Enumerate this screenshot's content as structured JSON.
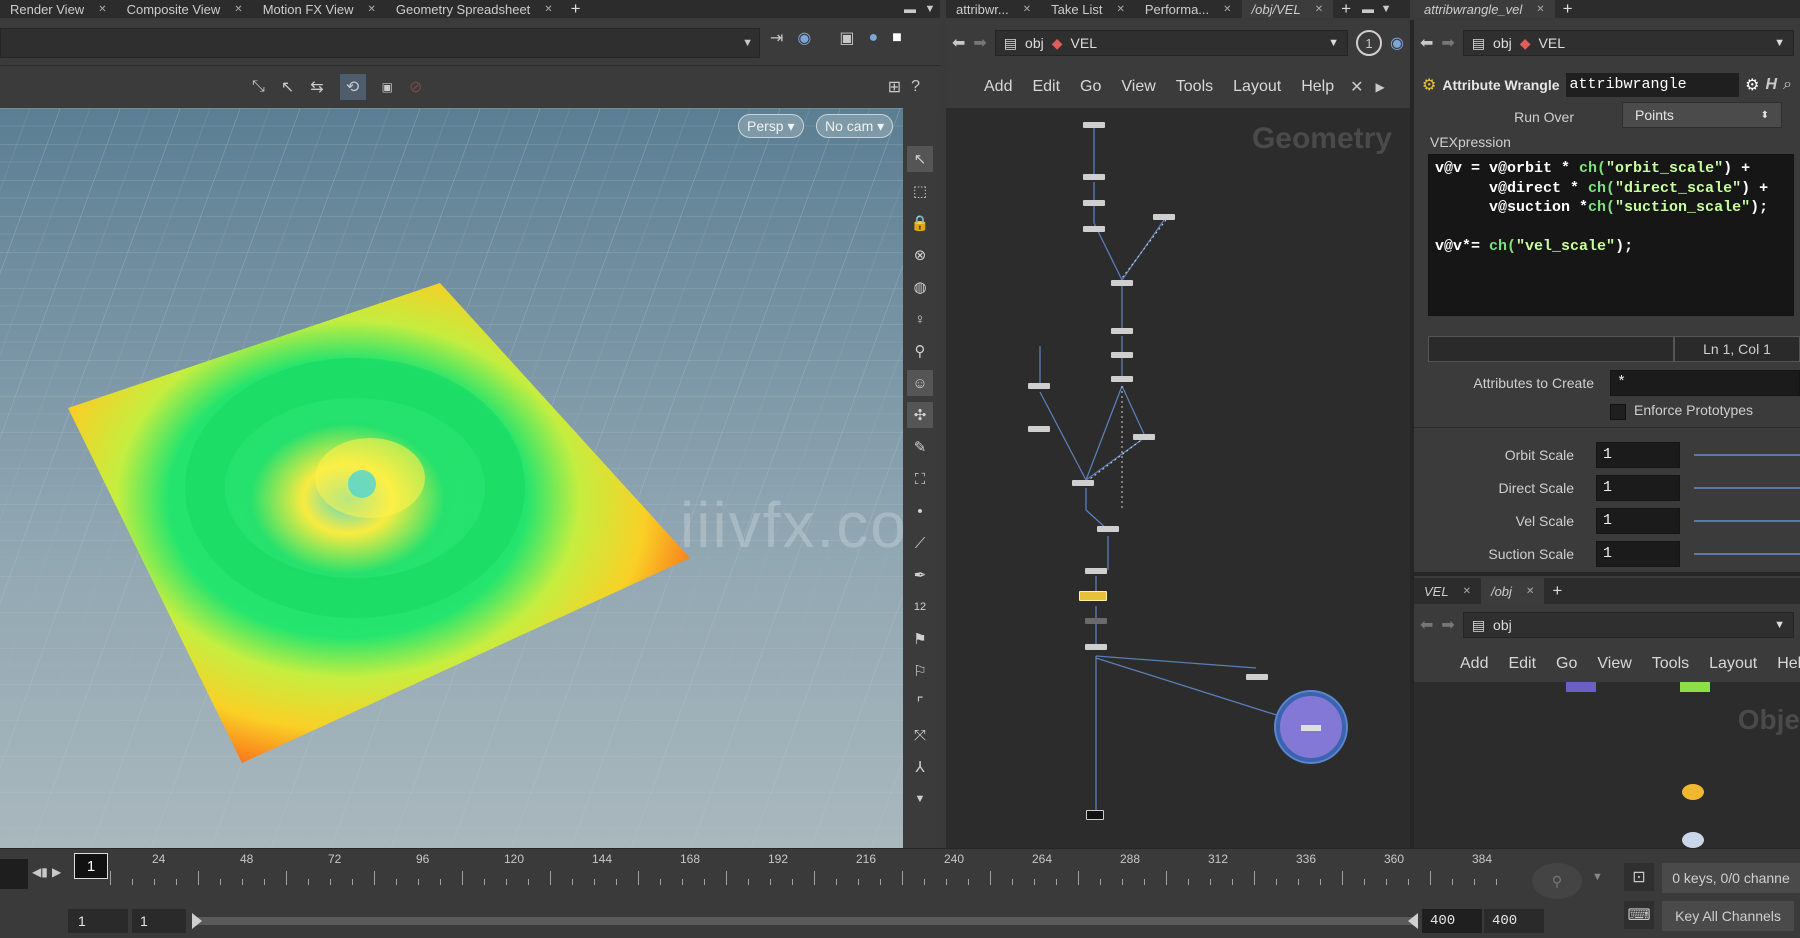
{
  "viewer_tabs": [
    {
      "label": "Render View"
    },
    {
      "label": "Composite View"
    },
    {
      "label": "Motion FX View"
    },
    {
      "label": "Geometry Spreadsheet"
    }
  ],
  "network_tabs": [
    {
      "label": "attribwr..."
    },
    {
      "label": "Take List"
    },
    {
      "label": "Performa..."
    },
    {
      "label": "/obj/VEL"
    }
  ],
  "param_tab": {
    "label": "attribwrangle_vel"
  },
  "network": {
    "path_root": "obj",
    "path_node": "VEL",
    "menus": [
      "Add",
      "Edit",
      "Go",
      "View",
      "Tools",
      "Layout",
      "Help"
    ],
    "context_label": "Geometry",
    "link_number": "1"
  },
  "viewport": {
    "persp_label": "Persp ▾",
    "cam_label": "No cam ▾",
    "watermark": "iiivfx.com"
  },
  "params": {
    "path_root": "obj",
    "path_node": "VEL",
    "node_type": "Attribute Wrangle",
    "node_name": "attribwrangle",
    "run_over_label": "Run Over",
    "run_over_value": "Points",
    "vex_label": "VEXpression",
    "code_lines": [
      [
        {
          "t": "v@v = v@orbit * ",
          "c": "#ffffff"
        },
        {
          "t": "ch(",
          "c": "#7fe07f"
        },
        {
          "t": "\"orbit_scale\"",
          "c": "#c8ff9e"
        },
        {
          "t": ") +",
          "c": "#ffffff"
        }
      ],
      [
        {
          "t": "      v@direct * ",
          "c": "#ffffff"
        },
        {
          "t": "ch(",
          "c": "#7fe07f"
        },
        {
          "t": "\"direct_scale\"",
          "c": "#c8ff9e"
        },
        {
          "t": ") +",
          "c": "#ffffff"
        }
      ],
      [
        {
          "t": "      v@suction *",
          "c": "#ffffff"
        },
        {
          "t": "ch(",
          "c": "#7fe07f"
        },
        {
          "t": "\"suction_scale\"",
          "c": "#c8ff9e"
        },
        {
          "t": ");",
          "c": "#ffffff"
        }
      ],
      [
        {
          "t": " ",
          "c": "#ffffff"
        }
      ],
      [
        {
          "t": "v@v*= ",
          "c": "#ffffff"
        },
        {
          "t": "ch(",
          "c": "#7fe07f"
        },
        {
          "t": "\"vel_scale\"",
          "c": "#c8ff9e"
        },
        {
          "t": ");",
          "c": "#ffffff"
        }
      ]
    ],
    "cursor_pos": "Ln 1, Col 1",
    "attr_create_label": "Attributes to Create",
    "attr_create_value": "*",
    "enforce_label": "Enforce Prototypes",
    "orbit_label": "Orbit Scale",
    "orbit_value": "1",
    "direct_label": "Direct Scale",
    "direct_value": "1",
    "vel_label": "Vel Scale",
    "vel_value": "1",
    "suction_label": "Suction Scale",
    "suction_value": "1"
  },
  "lower_net": {
    "tabs": [
      {
        "label": "VEL"
      },
      {
        "label": "/obj"
      }
    ],
    "path_root": "obj",
    "menus": [
      "Add",
      "Edit",
      "Go",
      "View",
      "Tools",
      "Layout",
      "Hel"
    ],
    "context_label": "Obje"
  },
  "timeline": {
    "ticks": [
      "24",
      "48",
      "72",
      "96",
      "120",
      "144",
      "168",
      "192",
      "216",
      "240",
      "264",
      "288",
      "312",
      "336",
      "360",
      "384"
    ],
    "current_frame": "1",
    "start": "1",
    "start2": "1",
    "end": "400",
    "end2": "400",
    "keys_label": "0 keys, 0/0 channe",
    "key_all_label": "Key All Channels"
  }
}
